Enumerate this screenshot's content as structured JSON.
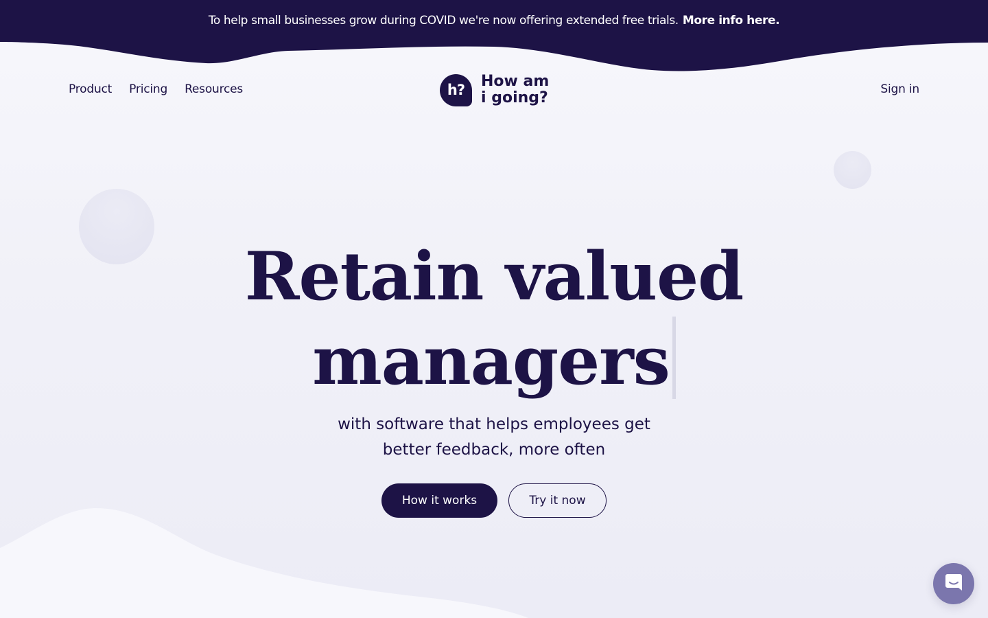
{
  "banner": {
    "message": "To help small businesses grow during COVID we're now offering extended free trials.",
    "link": "More info here."
  },
  "nav": {
    "items": [
      {
        "label": "Product"
      },
      {
        "label": "Pricing"
      },
      {
        "label": "Resources"
      }
    ],
    "sign_in": "Sign in"
  },
  "logo": {
    "mark": "h?",
    "line1": "How am",
    "line2": "i going?"
  },
  "hero": {
    "headline_line1": "Retain valued",
    "headline_line2": "managers",
    "sub_line1": "with software that helps employees get",
    "sub_line2": "better feedback, more often",
    "primary_cta": "How it works",
    "secondary_cta": "Try it now"
  },
  "icons": {
    "chat": "chat-bubble-icon"
  },
  "colors": {
    "brand": "#1d1346",
    "chat_button": "#7b76ad",
    "background": "#f4f4fa"
  }
}
